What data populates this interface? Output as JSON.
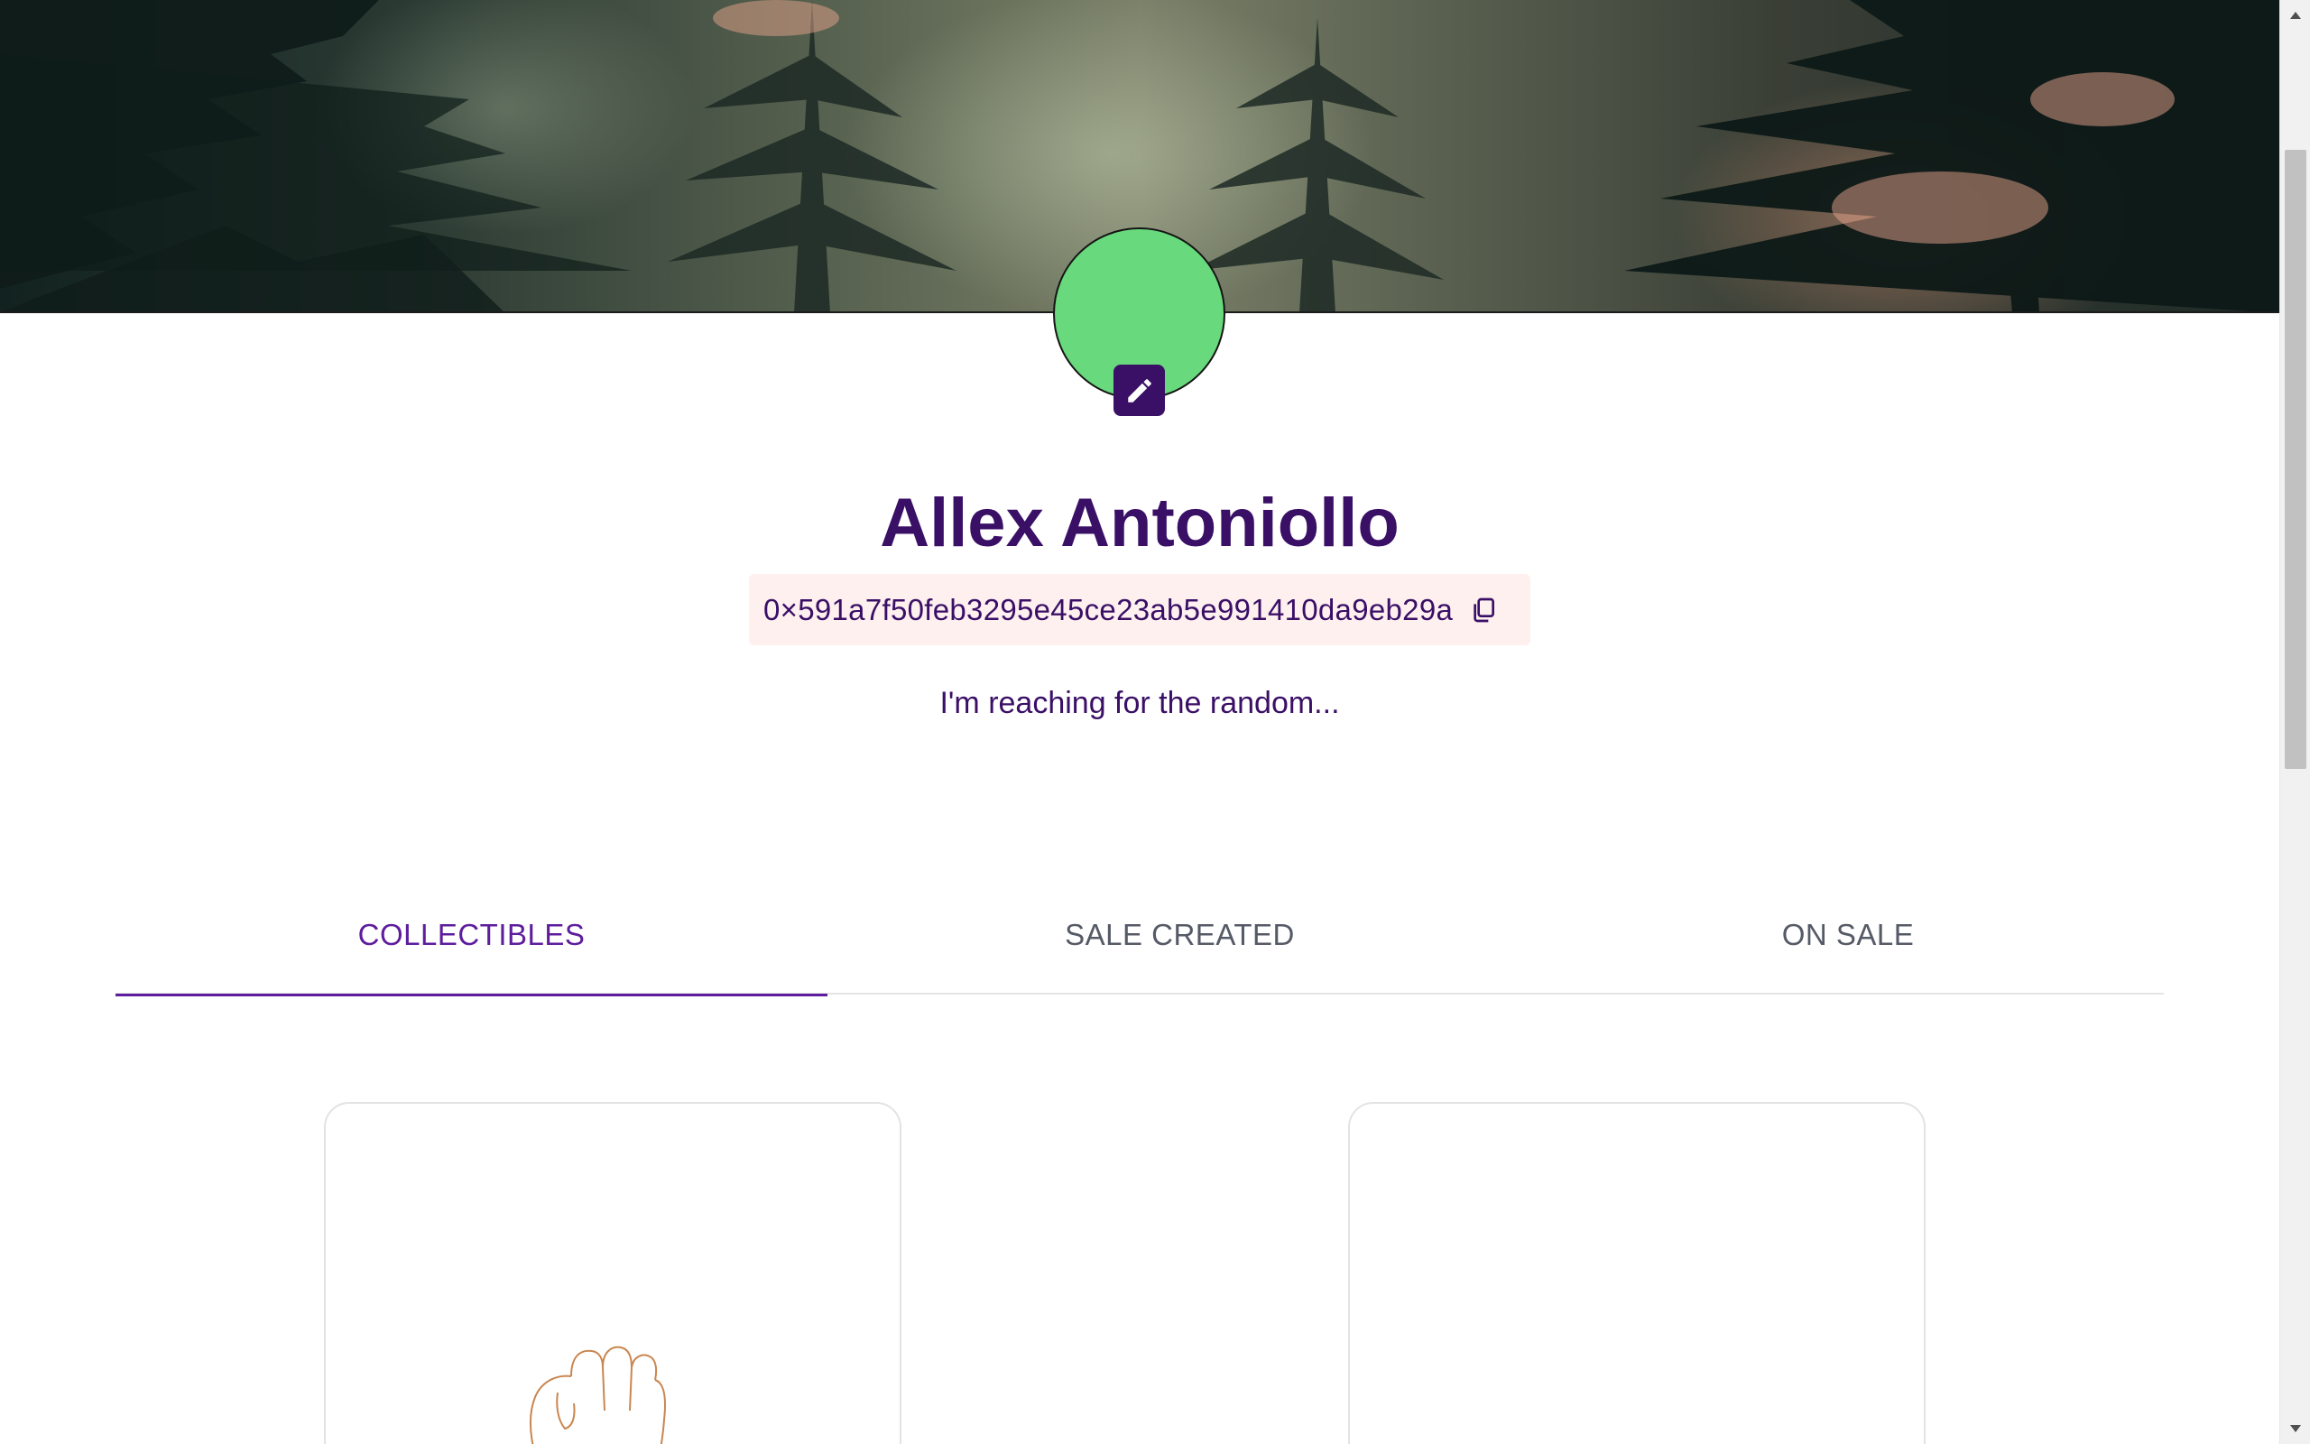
{
  "profile": {
    "name": "Allex Antoniollo",
    "address": "0×591a7f50feb3295e45ce23ab5e991410da9eb29a",
    "bio": "I'm reaching for the random...",
    "avatar_color": "#68d97c"
  },
  "tabs": [
    {
      "label": "COLLECTIBLES",
      "active": true
    },
    {
      "label": "SALE CREATED",
      "active": false
    },
    {
      "label": "ON SALE",
      "active": false
    }
  ],
  "icons": {
    "edit": "pencil-icon",
    "copy": "copy-icon",
    "scroll_up": "triangle-up-icon",
    "scroll_down": "triangle-down-icon"
  },
  "colors": {
    "primary": "#3a0f66",
    "tab_active": "#5d1d9c",
    "address_bg": "#fdf0ef",
    "tab_inactive": "#555a66"
  }
}
